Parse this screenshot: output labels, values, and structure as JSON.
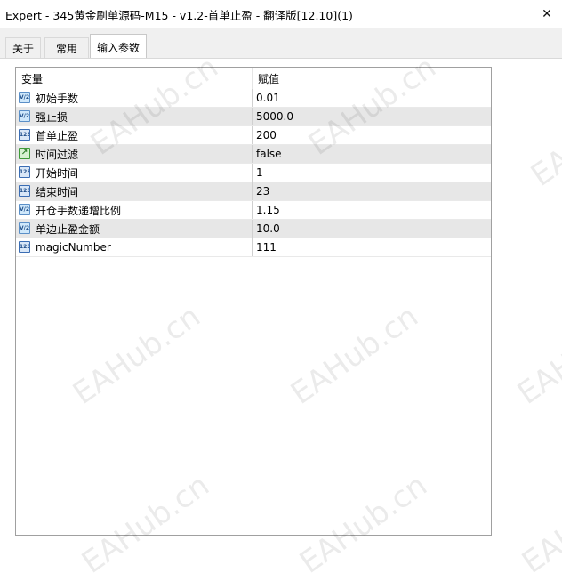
{
  "window": {
    "title": "Expert - 345黄金刷单源码-M15 - v1.2-首单止盈 - 翻译版[12.10](1)",
    "close_glyph": "✕"
  },
  "tabs": [
    {
      "label": "关于"
    },
    {
      "label": "常用"
    },
    {
      "label": "输入参数",
      "active": true
    }
  ],
  "grid": {
    "headers": {
      "variable": "变量",
      "value": "赋值"
    },
    "rows": [
      {
        "name": "初始手数",
        "value": "0.01",
        "type": "double",
        "icon_text": "V/2"
      },
      {
        "name": "强止损",
        "value": "5000.0",
        "type": "double",
        "icon_text": "V/2"
      },
      {
        "name": "首单止盈",
        "value": "200",
        "type": "int",
        "icon_text": "123"
      },
      {
        "name": "时间过滤",
        "value": "false",
        "type": "bool",
        "icon_text": "↗"
      },
      {
        "name": "开始时间",
        "value": "1",
        "type": "int",
        "icon_text": "123"
      },
      {
        "name": "结束时间",
        "value": "23",
        "type": "int",
        "icon_text": "123"
      },
      {
        "name": "开仓手数递增比例",
        "value": "1.15",
        "type": "double",
        "icon_text": "V/2"
      },
      {
        "name": "单边止盈金额",
        "value": "10.0",
        "type": "double",
        "icon_text": "V/2"
      },
      {
        "name": "magicNumber",
        "value": "111",
        "type": "int",
        "icon_text": "123"
      }
    ]
  },
  "watermark": {
    "text": "EAHub.cn"
  }
}
